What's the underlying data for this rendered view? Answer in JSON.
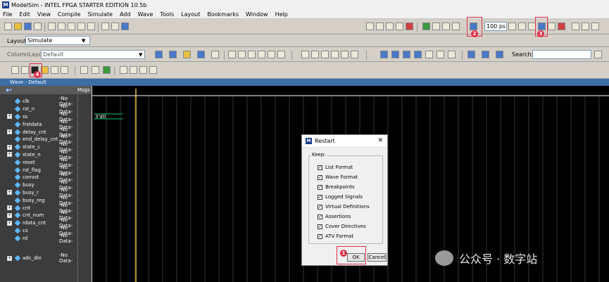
{
  "app": {
    "title": "ModelSim - INTEL FPGA STARTER EDITION 10.5b",
    "logo_letter": "M"
  },
  "menu": [
    "File",
    "Edit",
    "View",
    "Compile",
    "Simulate",
    "Add",
    "Wave",
    "Tools",
    "Layout",
    "Bookmarks",
    "Window",
    "Help"
  ],
  "toolbar": {
    "time_value": "100 ps",
    "layout_label": "Layout",
    "layout_value": "Simulate",
    "column_layout_label": "ColumnLayout",
    "column_layout_value": "Default",
    "search_label": "Search:"
  },
  "badges": [
    "1",
    "2",
    "3",
    "4"
  ],
  "wave": {
    "title": "Wave - Default",
    "msgs_label": "Msgs",
    "signals": [
      {
        "name": "clk",
        "value": "-No Data-",
        "expand": false
      },
      {
        "name": "rst_n",
        "value": "-No Data-",
        "expand": false
      },
      {
        "name": "ss",
        "value": "-No Data-",
        "expand": true
      },
      {
        "name": "frstdata",
        "value": "-No Data-",
        "expand": false
      },
      {
        "name": "delay_cnt",
        "value": "-No Data-",
        "expand": true
      },
      {
        "name": "end_delay_cnt",
        "value": "-No Data-",
        "expand": false
      },
      {
        "name": "state_c",
        "value": "-No Data-",
        "expand": true
      },
      {
        "name": "state_n",
        "value": "-No Data-",
        "expand": true
      },
      {
        "name": "reset",
        "value": "-No Data-",
        "expand": false
      },
      {
        "name": "rst_flag",
        "value": "-No Data-",
        "expand": false
      },
      {
        "name": "convst",
        "value": "-No Data-",
        "expand": false
      },
      {
        "name": "busy",
        "value": "-No Data-",
        "expand": false
      },
      {
        "name": "busy_r",
        "value": "-No Data-",
        "expand": true
      },
      {
        "name": "busy_reg",
        "value": "-No Data-",
        "expand": false
      },
      {
        "name": "cnt",
        "value": "-No Data-",
        "expand": true
      },
      {
        "name": "cnt_num",
        "value": "-No Data-",
        "expand": true
      },
      {
        "name": "rdata_cnt",
        "value": "-No Data-",
        "expand": true
      },
      {
        "name": "cs",
        "value": "-No Data-",
        "expand": false
      },
      {
        "name": "rd",
        "value": "-No Data-",
        "expand": false
      },
      {
        "name": "adc_din",
        "value": "-No Data-",
        "expand": true
      }
    ],
    "bus_value": "3'd0"
  },
  "dialog": {
    "title": "Restart",
    "close": "✕",
    "keep_label": "Keep:",
    "options": [
      "List Format",
      "Wave Format",
      "Breakpoints",
      "Logged Signals",
      "Virtual Definitions",
      "Assertions",
      "Cover Directives",
      "ATV Format"
    ],
    "ok_label": "OK",
    "cancel_label": "Cancel"
  },
  "watermark": {
    "text": "公众号 · 数字站"
  },
  "colors": {
    "accent_red": "#e0304a",
    "wave_bg": "#000000",
    "cursor": "#e8c040"
  }
}
